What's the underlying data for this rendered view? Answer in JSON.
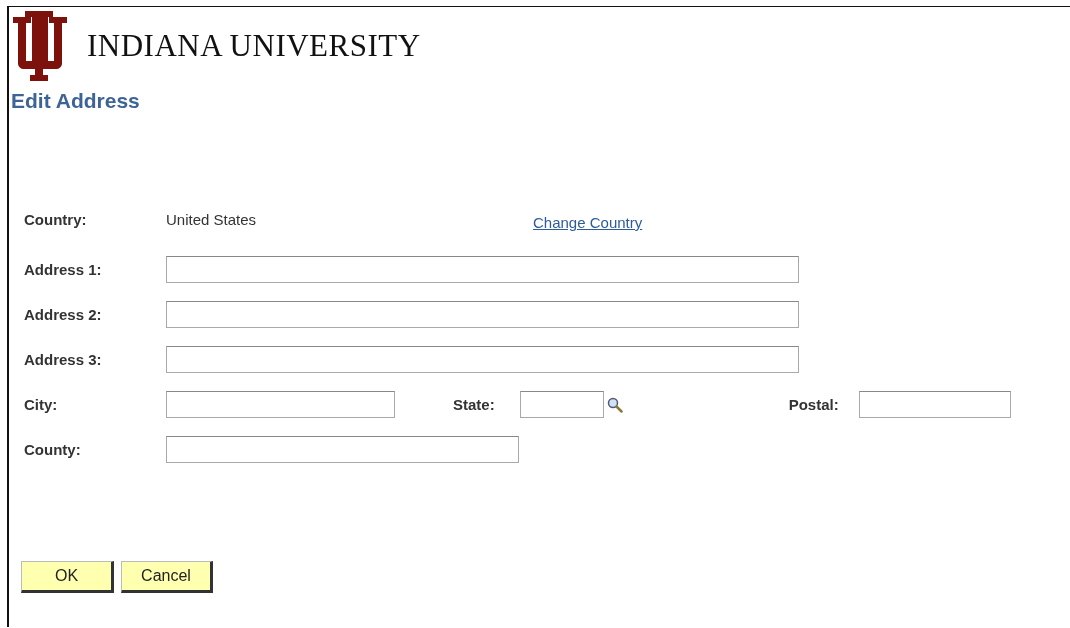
{
  "header": {
    "logo_text": "INDIANA UNIVERSITY",
    "title": "Edit Address"
  },
  "country": {
    "label": "Country:",
    "value": "United States",
    "link": "Change Country"
  },
  "fields": [
    {
      "kind": "wide",
      "label": "Address 1:"
    },
    {
      "kind": "wide",
      "label": "Address 2:"
    },
    {
      "kind": "wide",
      "label": "Address 3:"
    },
    {
      "kind": "city",
      "label": "City:",
      "state_label": "State:",
      "postal_label": "Postal:"
    },
    {
      "kind": "county",
      "label": "County:"
    }
  ],
  "buttons": [
    "OK",
    "Cancel"
  ]
}
